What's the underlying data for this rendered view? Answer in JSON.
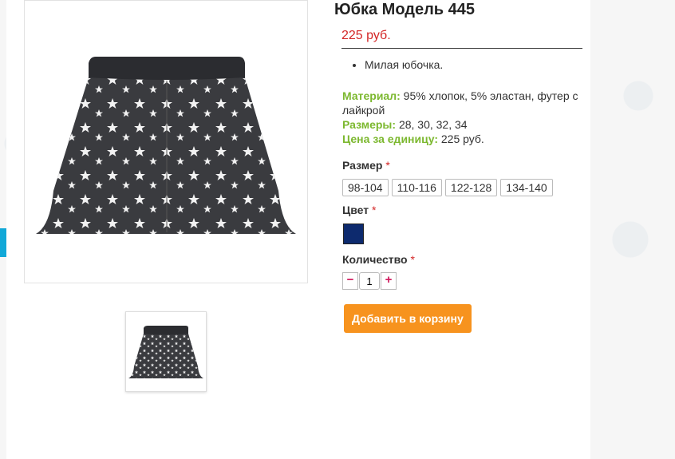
{
  "product": {
    "title": "Юбка Модель 445",
    "price": "225 руб.",
    "description": [
      "Милая юбочка."
    ],
    "specs": [
      {
        "label": "Материал:",
        "value": "95% хлопок, 5% эластан, футер с лайкрой"
      },
      {
        "label": "Размеры:",
        "value": "28, 30, 32, 34"
      },
      {
        "label": "Цена за единицу:",
        "value": "225 руб."
      }
    ]
  },
  "options": {
    "size_label": "Размер",
    "sizes": [
      "98-104",
      "110-116",
      "122-128",
      "134-140"
    ],
    "color_label": "Цвет",
    "color_swatch": "#0d2a6e",
    "quantity_label": "Количество",
    "quantity_value": "1",
    "required_mark": "*"
  },
  "actions": {
    "minus": "−",
    "plus": "+",
    "add_to_cart": "Добавить в корзину"
  },
  "colors": {
    "accent_orange": "#f7931e",
    "price_red": "#d32525",
    "label_green": "#7cb82f",
    "side_tab_blue": "#11a8d8"
  }
}
